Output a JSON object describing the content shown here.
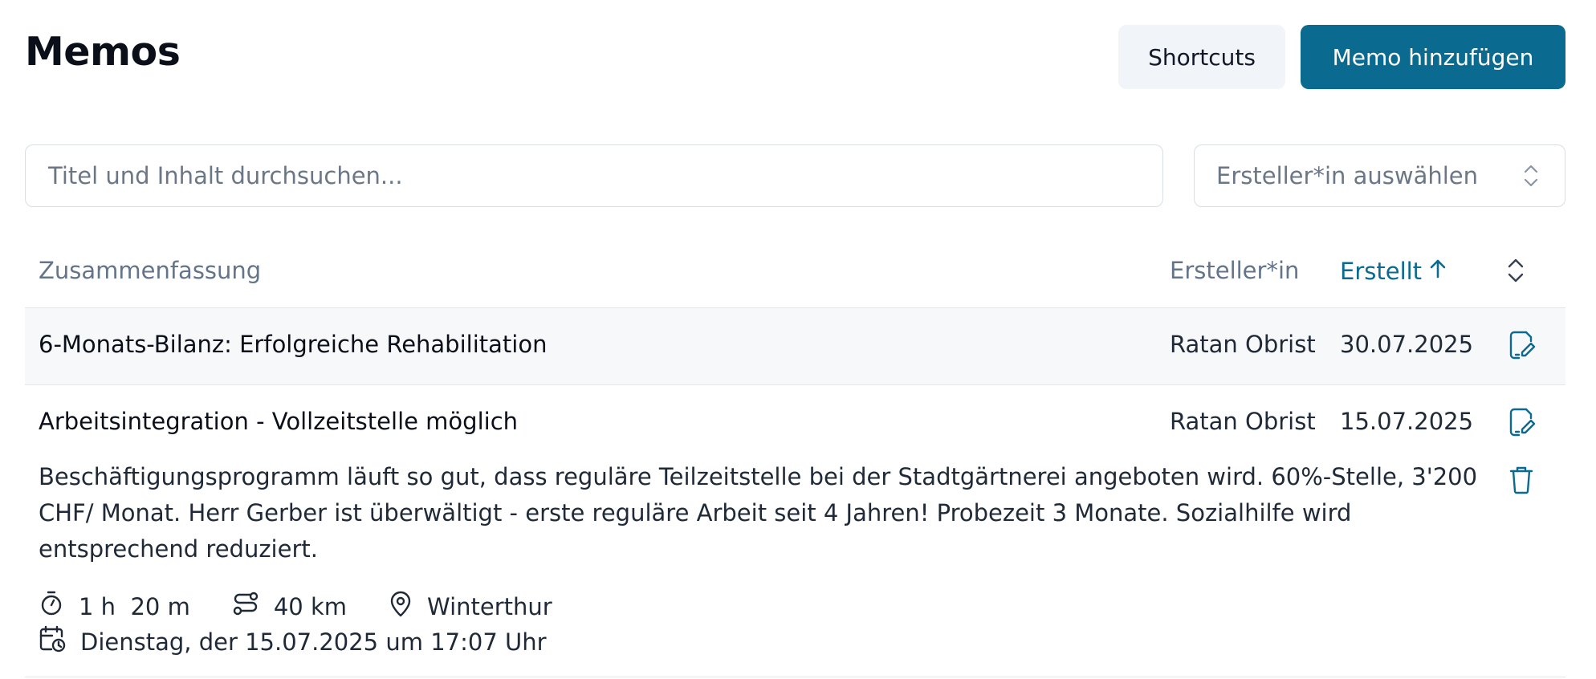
{
  "header": {
    "title": "Memos",
    "shortcuts_label": "Shortcuts",
    "add_label": "Memo hinzufügen"
  },
  "filters": {
    "search_placeholder": "Titel und Inhalt durchsuchen...",
    "creator_placeholder": "Ersteller*in auswählen"
  },
  "table": {
    "columns": {
      "summary": "Zusammenfassung",
      "creator": "Ersteller*in",
      "created": "Erstellt"
    },
    "rows": [
      {
        "title": "6-Monats-Bilanz: Erfolgreiche Rehabilitation",
        "creator": "Ratan Obrist",
        "date": "30.07.2025"
      },
      {
        "title": "Arbeitsintegration - Vollzeitstelle möglich",
        "creator": "Ratan Obrist",
        "date": "15.07.2025",
        "body": "Beschäftigungsprogramm läuft so gut, dass reguläre Teilzeitstelle bei der Stadtgärtnerei angeboten wird. 60%-Stelle, 3'200 CHF/ Monat. Herr Gerber ist überwältigt - erste reguläre Arbeit seit 4 Jahren! Probezeit 3 Monate. Sozialhilfe wird entsprechend reduziert.",
        "duration": "1 h  20 m",
        "distance": "40 km",
        "location": "Winterthur",
        "datetime": "Dienstag, der 15.07.2025 um 17:07 Uhr"
      }
    ]
  },
  "colors": {
    "accent": "#0a6a8f",
    "muted_text": "#64748b",
    "border": "#e3e7ec"
  },
  "icons": [
    "chevron-up-down-icon",
    "arrow-up-icon",
    "edit-icon",
    "trash-icon",
    "timer-icon",
    "route-icon",
    "map-pin-icon",
    "calendar-clock-icon"
  ]
}
